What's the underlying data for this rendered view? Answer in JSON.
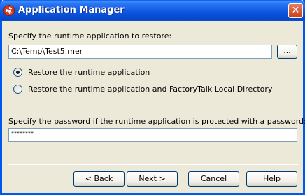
{
  "window": {
    "title": "Application Manager",
    "close_glyph": "✕"
  },
  "restore": {
    "prompt": "Specify the runtime application to restore:",
    "path_value": "C:\\Temp\\Test5.mer",
    "browse_label": "..."
  },
  "options": [
    {
      "label": "Restore the runtime application",
      "checked": true
    },
    {
      "label": "Restore the runtime application and FactoryTalk Local Directory",
      "checked": false
    }
  ],
  "password": {
    "prompt": "Specify the password if the runtime application is protected with a password:",
    "value": "********"
  },
  "buttons": {
    "back": "< Back",
    "next": "Next >",
    "cancel": "Cancel",
    "help": "Help"
  }
}
